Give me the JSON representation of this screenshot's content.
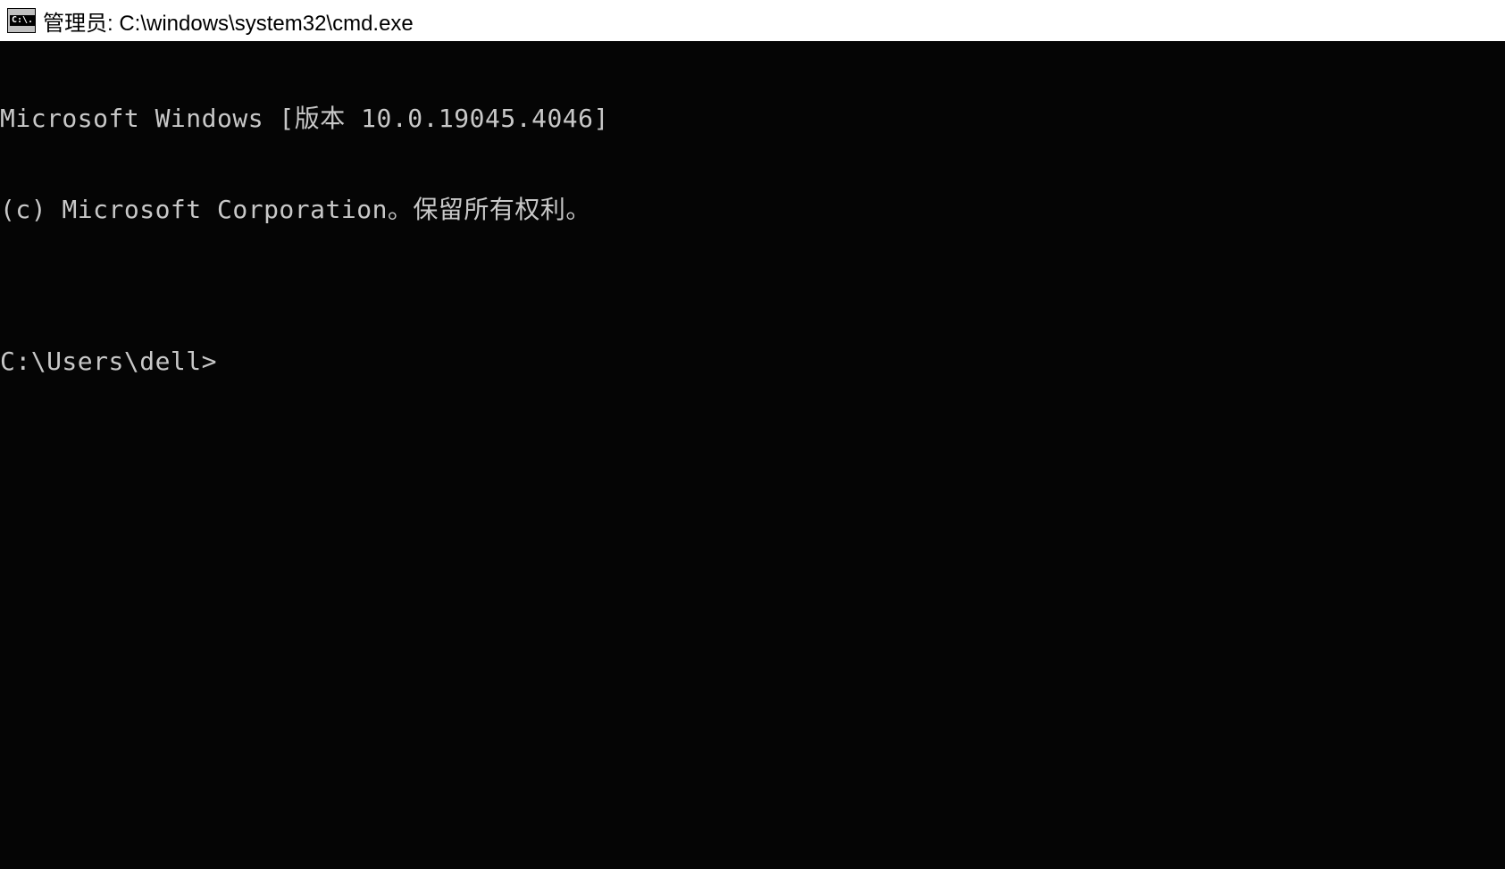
{
  "titlebar": {
    "icon_label": "C:\\.",
    "title": "管理员: C:\\windows\\system32\\cmd.exe"
  },
  "terminal": {
    "line_version": "Microsoft Windows [版本 10.0.19045.4046]",
    "line_copyright": "(c) Microsoft Corporation。保留所有权利。",
    "blank": "",
    "prompt": "C:\\Users\\dell>"
  }
}
